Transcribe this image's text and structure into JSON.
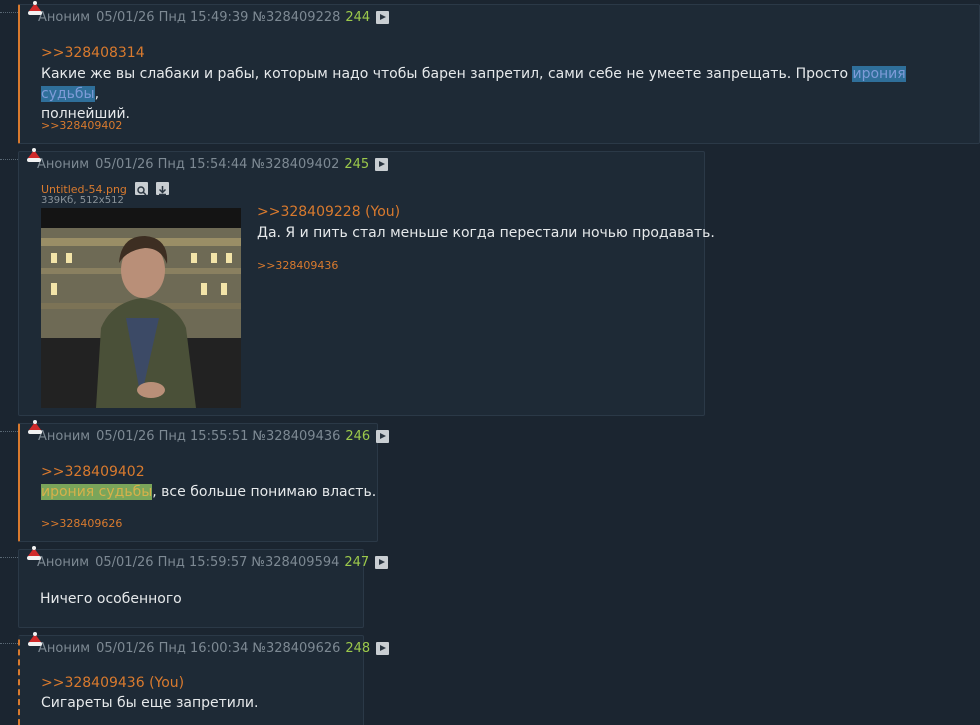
{
  "posts": [
    {
      "author": "Аноним",
      "date": "05/01/26 Пнд 15:49:39",
      "number": "№328409228",
      "counter": "244",
      "reply_to": ">>328408314",
      "text_before": "Какие же вы слабаки и рабы, которым надо чтобы барен запретил, сами себе не умеете запрещать. Просто ",
      "spoiler": "ирония судьбы",
      "text_after": ",",
      "text_line2": "полнейший.",
      "backref": ">>328409402"
    },
    {
      "author": "Аноним",
      "date": "05/01/26 Пнд 15:54:44",
      "number": "№328409402",
      "counter": "245",
      "file_name": "Untitled-54.png",
      "file_meta": "339Кб, 512x512",
      "reply_to": ">>328409228 (You)",
      "text": "Да. Я и пить стал меньше когда перестали ночью продавать.",
      "backref": ">>328409436"
    },
    {
      "author": "Аноним",
      "date": "05/01/26 Пнд 15:55:51",
      "number": "№328409436",
      "counter": "246",
      "reply_to": ">>328409402",
      "spoiler": "ирония судьбы",
      "text_after": ", все больше понимаю власть.",
      "backref": ">>328409626"
    },
    {
      "author": "Аноним",
      "date": "05/01/26 Пнд 15:59:57",
      "number": "№328409594",
      "counter": "247",
      "text": "Ничего особенного"
    },
    {
      "author": "Аноним",
      "date": "05/01/26 Пнд 16:00:34",
      "number": "№328409626",
      "counter": "248",
      "reply_to": ">>328409436 (You)",
      "text": "Сигареты бы еще запретили."
    }
  ],
  "colors": {
    "background": "#1b2530",
    "post_bg": "#1e2a36",
    "accent": "#d97a2e",
    "counter": "#9cc94b",
    "text": "#e6e9eb",
    "meta": "#7d8993"
  },
  "icons": {
    "post_hat": "santa-hat-icon",
    "play": "play-icon",
    "search": "search-icon",
    "download": "download-icon"
  }
}
